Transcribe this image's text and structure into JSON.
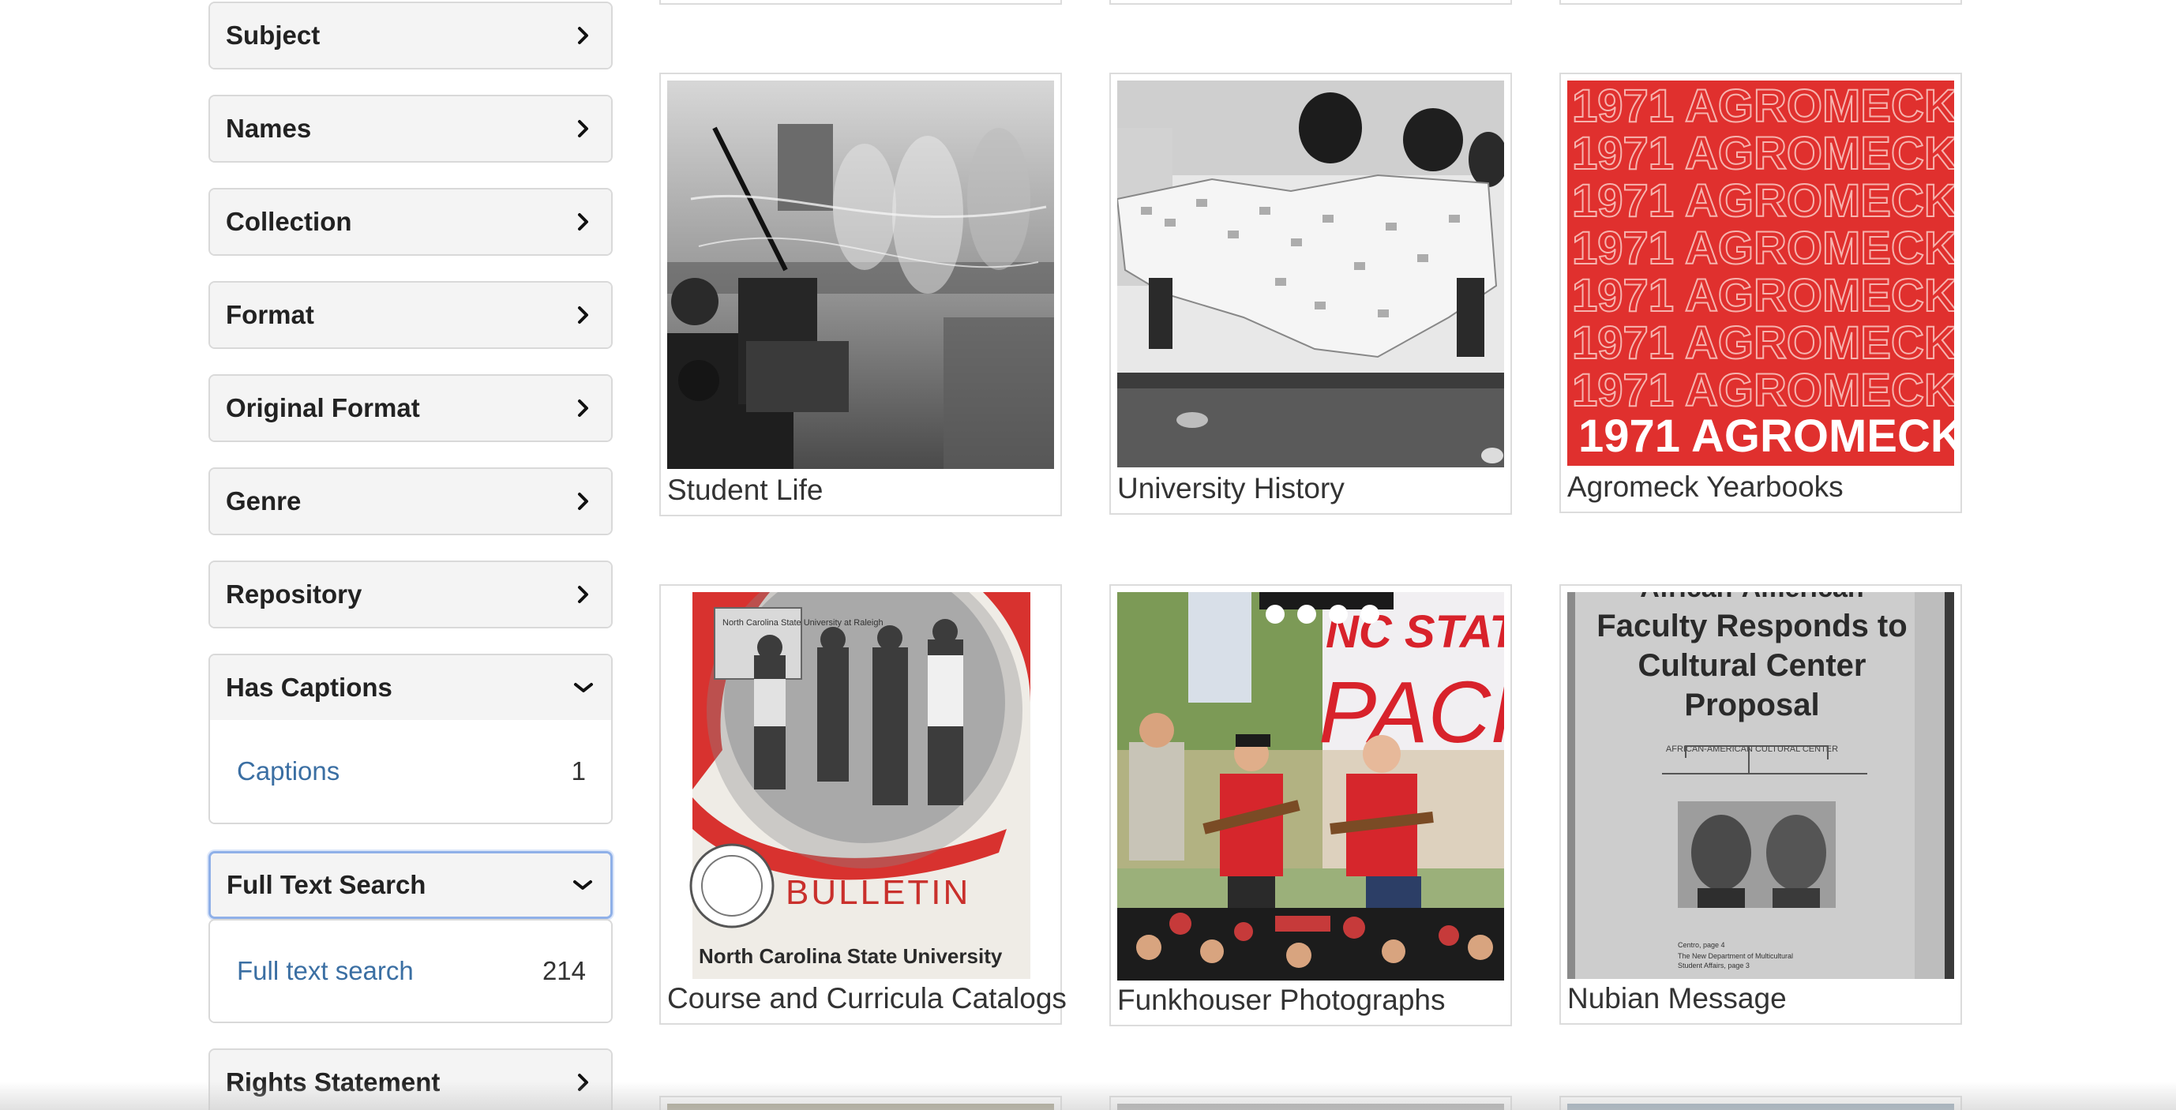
{
  "sidebar": {
    "facets": [
      {
        "title": "Subject",
        "state": "collapsed"
      },
      {
        "title": "Names",
        "state": "collapsed"
      },
      {
        "title": "Collection",
        "state": "collapsed"
      },
      {
        "title": "Format",
        "state": "collapsed"
      },
      {
        "title": "Original Format",
        "state": "collapsed"
      },
      {
        "title": "Genre",
        "state": "collapsed"
      },
      {
        "title": "Repository",
        "state": "collapsed"
      },
      {
        "title": "Has Captions",
        "state": "expanded",
        "items": [
          {
            "label": "Captions",
            "count": "1"
          }
        ]
      },
      {
        "title": "Full Text Search",
        "state": "expanded",
        "items": [
          {
            "label": "Full text search",
            "count": "214"
          }
        ]
      },
      {
        "title": "Rights Statement",
        "state": "collapsed"
      }
    ]
  },
  "collections": [
    {
      "label": "Student Life",
      "thumb": "black-and-white photo of a blurred lab workshop"
    },
    {
      "label": "University History",
      "thumb": "black-and-white photo of women holding a map of cards"
    },
    {
      "label": "Agromeck Yearbooks",
      "thumb": "red yearbook cover"
    },
    {
      "label": "Course and Curricula Catalogs",
      "thumb": "bulletin cover with four people"
    },
    {
      "label": "Funkhouser Photographs",
      "thumb": "color concert photo on stage"
    },
    {
      "label": "Nubian Message",
      "thumb": "newspaper clipping"
    }
  ],
  "thumb_text": {
    "agromeck_cover": "1971 AGROMECK",
    "bulletin_word": "BULLETIN",
    "bulletin_university": "North Carolina State University",
    "bulletin_sign": "North Carolina State University at Raleigh",
    "concert_banner_top": "NC STATE U",
    "concert_banner_main": "PACKAPA",
    "nubian_header": "African-American",
    "nubian_headline_1": "Faculty Responds to",
    "nubian_headline_2": "Cultural Center",
    "nubian_headline_3": "Proposal",
    "nubian_caption": "AFRICAN-AMERICAN CULTURAL CENTER",
    "nubian_footer_1": "Centro, page 4",
    "nubian_footer_2": "The New Department of Multicultural",
    "nubian_footer_3": "Student Affairs, page 3"
  },
  "colors": {
    "link": "#3b6fa3",
    "facet_bg": "#f4f4f4",
    "border": "#d9d9d9",
    "focus": "#8fb0e8",
    "agromeck_red": "#e0302e"
  },
  "icons": {
    "collapsed": "chevron-right-icon",
    "expanded": "chevron-down-icon"
  }
}
